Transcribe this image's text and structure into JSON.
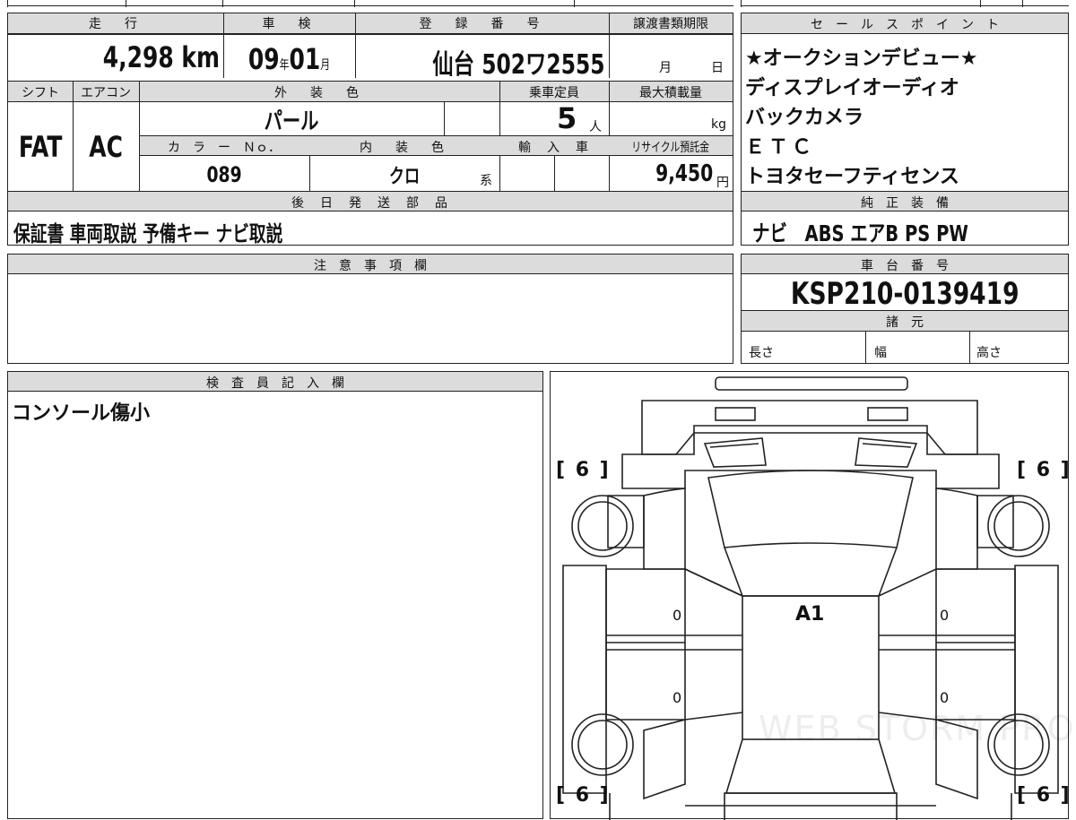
{
  "main_table": {
    "headers": {
      "mileage": "走　行",
      "inspection": "車　検",
      "registration": "登　録　番　号",
      "transfer_deadline": "譲渡書類期限",
      "shift": "シフト",
      "aircon": "エアコン",
      "exterior_color": "外　装　色",
      "capacity": "乗車定員",
      "max_load": "最大積載量",
      "color_no": "カ　ラ　ー　Ｎｏ．",
      "interior_color": "内　装　色",
      "import": "輸　入　車",
      "recycle_fee": "リサイクル預託金",
      "later_parts": "後　日　発　送　部　品"
    },
    "mileage_value": "4,298",
    "mileage_unit": "km",
    "inspection_year": "09",
    "year_unit": "年",
    "inspection_month": "01",
    "month_unit": "月",
    "registration_value": "仙台 502ワ2555",
    "deadline_month_unit": "月",
    "deadline_day_unit": "日",
    "shift_value": "FAT",
    "aircon_value": "AC",
    "exterior_value": "パール",
    "capacity_value": "5",
    "capacity_unit": "人",
    "max_load_unit": "kg",
    "color_no_value": "089",
    "interior_value": "クロ",
    "interior_unit": "系",
    "recycle_value": "9,450",
    "recycle_unit": "円",
    "later_parts_value": "保証書 車両取説 予備キー ナビ取説"
  },
  "sales_points": {
    "header": "セ　ー　ル　ス　ポ　イ　ン　ト",
    "items": [
      "★オークションデビュー★",
      "ディスプレイオーディオ",
      "バックカメラ",
      "ＥＴＣ",
      "トヨタセーフティセンス"
    ]
  },
  "genuine_equipment": {
    "header": "純　正　装　備",
    "value": "ナビ　ABS エアB PS PW"
  },
  "notes": {
    "header": "注　意　事　項　欄",
    "value": ""
  },
  "chassis": {
    "header": "車　台　番　号",
    "value": "KSP210-0139419",
    "spec_header": "諸　元",
    "length_label": "長さ",
    "width_label": "幅",
    "height_label": "高さ"
  },
  "inspector": {
    "header": "検　査　員　記　入　欄",
    "value": "コンソール傷小"
  },
  "diagram": {
    "tire_front_left": "[ 6 ]",
    "tire_front_right": "[ 6 ]",
    "tire_rear_left": "[ 6 ]",
    "tire_rear_right": "[ 6 ]",
    "roof_mark": "A1",
    "left_front_door": "0",
    "left_rear_door": "0",
    "right_front_door": "0",
    "right_rear_door": "0",
    "watermark": "WEB STORM PRO"
  }
}
